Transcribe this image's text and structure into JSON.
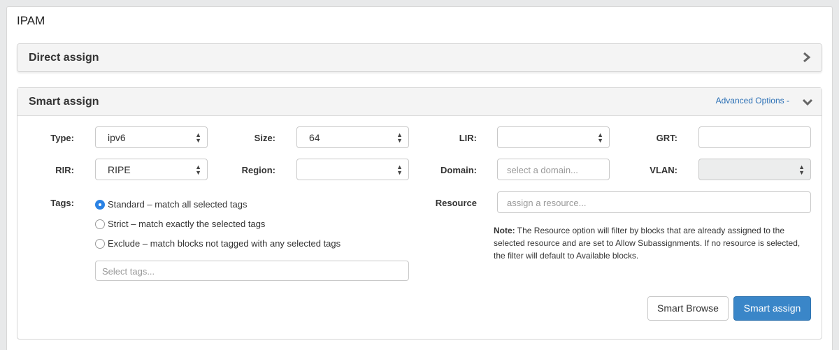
{
  "page_title": "IPAM",
  "direct_assign": {
    "title": "Direct assign"
  },
  "smart_assign": {
    "title": "Smart assign",
    "advanced_options": "Advanced Options -",
    "fields": {
      "type": {
        "label": "Type:",
        "value": "ipv6"
      },
      "size": {
        "label": "Size:",
        "value": "64"
      },
      "lir": {
        "label": "LIR:",
        "value": ""
      },
      "grt": {
        "label": "GRT:",
        "value": ""
      },
      "rir": {
        "label": "RIR:",
        "value": "RIPE"
      },
      "region": {
        "label": "Region:",
        "value": ""
      },
      "domain": {
        "label": "Domain:",
        "placeholder": "select a domain..."
      },
      "vlan": {
        "label": "VLAN:",
        "value": ""
      },
      "tags": {
        "label": "Tags:",
        "placeholder": "Select tags..."
      },
      "resource": {
        "label": "Resource",
        "placeholder": "assign a resource..."
      }
    },
    "tag_modes": [
      {
        "label": "Standard – match all selected tags",
        "selected": true
      },
      {
        "label": "Strict – match exactly the selected tags",
        "selected": false
      },
      {
        "label": "Exclude – match blocks not tagged with any selected tags",
        "selected": false
      }
    ],
    "note": {
      "prefix": "Note:",
      "text": " The Resource option will filter by blocks that are already assigned to the selected resource and are set to Allow Subassignments. If no resource is selected, the filter will default to Available blocks."
    },
    "buttons": {
      "smart_browse": "Smart Browse",
      "smart_assign": "Smart assign"
    }
  },
  "colors": {
    "primary": "#3a86c8",
    "link": "#2a6fb5",
    "radio_on": "#2a82e4"
  },
  "icons": {
    "expand": "chevron-right-icon",
    "collapse": "chevron-down-icon",
    "select": "updown-arrows-icon"
  }
}
